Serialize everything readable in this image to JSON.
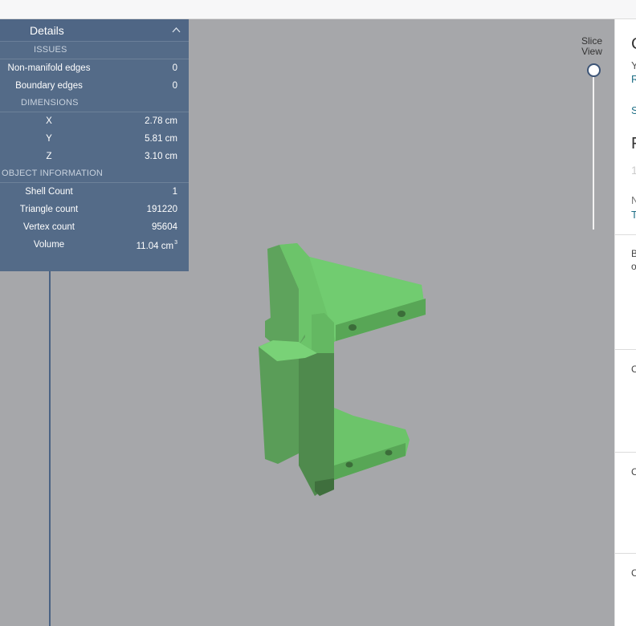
{
  "details": {
    "title": "Details",
    "sections": [
      {
        "heading": "ISSUES",
        "rows": [
          {
            "label": "Non-manifold edges",
            "value": "0"
          },
          {
            "label": "Boundary edges",
            "value": "0"
          }
        ]
      },
      {
        "heading": "DIMENSIONS",
        "rows": [
          {
            "label": "X",
            "value": "2.78 cm"
          },
          {
            "label": "Y",
            "value": "5.81 cm"
          },
          {
            "label": "Z",
            "value": "3.10 cm"
          }
        ]
      },
      {
        "heading": "OBJECT INFORMATION",
        "rows": [
          {
            "label": "Shell Count",
            "value": "1"
          },
          {
            "label": "Triangle count",
            "value": "191220"
          },
          {
            "label": "Vertex count",
            "value": "95604"
          },
          {
            "label": "Volume",
            "value": "11.04 cm",
            "sup": "3"
          }
        ]
      }
    ]
  },
  "slice": {
    "line1": "Slice",
    "line2": "View"
  },
  "right_panel": {
    "items": [
      "C",
      "Y",
      "R",
      "S",
      "F",
      "1",
      "N",
      "T",
      "B",
      "o",
      "C",
      "C",
      "C"
    ]
  },
  "colors": {
    "panel_bg": "#546b88",
    "viewport_bg": "#a6a7aa",
    "model_green": "#6cc46a",
    "accent_teal": "#1f6f86"
  },
  "icons": {
    "collapse": "chevron-up-icon",
    "slice_handle": "slider-knob"
  }
}
